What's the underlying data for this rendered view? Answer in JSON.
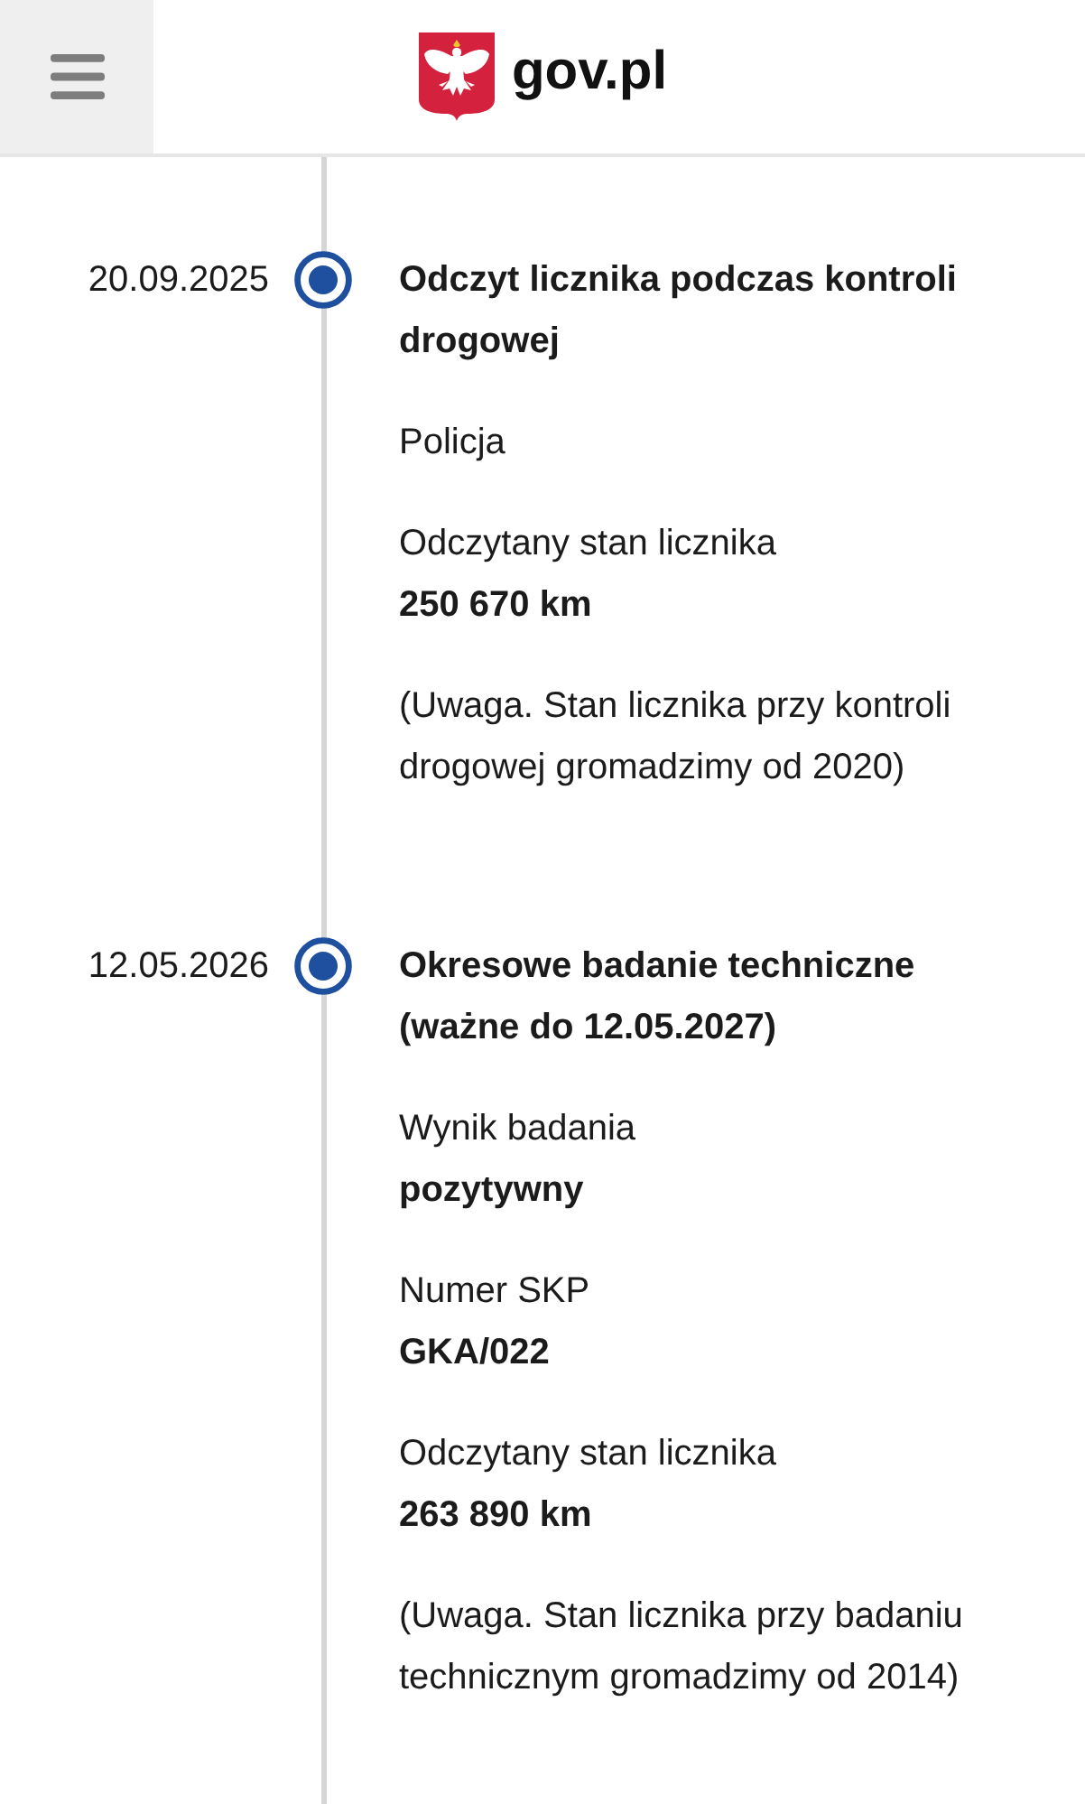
{
  "header": {
    "site_name": "gov.pl"
  },
  "timeline": [
    {
      "date": "20.09.2025",
      "title": "Odczyt licznika podczas kontroli drogowej",
      "details": [
        {
          "kind": "text",
          "text": "Policja"
        },
        {
          "kind": "pair",
          "label": "Odczytany stan licznika",
          "value": "250 670 km"
        },
        {
          "kind": "text",
          "text": "(Uwaga. Stan licznika przy kontroli drogowej gromadzimy od 2020)"
        }
      ]
    },
    {
      "date": "12.05.2026",
      "title": "Okresowe badanie techniczne (ważne do 12.05.2027)",
      "details": [
        {
          "kind": "pair",
          "label": "Wynik badania",
          "value": "pozytywny"
        },
        {
          "kind": "pair",
          "label": "Numer SKP",
          "value": "GKA/022"
        },
        {
          "kind": "pair",
          "label": "Odczytany stan licznika",
          "value": "263 890 km"
        },
        {
          "kind": "text",
          "text": "(Uwaga. Stan licznika przy badaniu technicznym gromadzimy od 2014)"
        }
      ]
    }
  ]
}
